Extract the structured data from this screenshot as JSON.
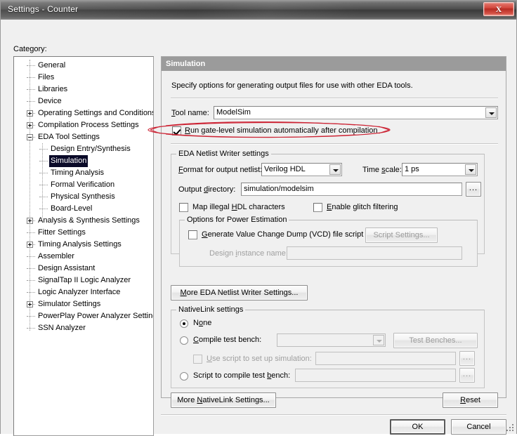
{
  "window": {
    "title": "Settings - Counter",
    "close_label": "X"
  },
  "sidebar": {
    "label": "Category:",
    "items": [
      {
        "label": "General",
        "level": 1,
        "expander": "none",
        "selected": false
      },
      {
        "label": "Files",
        "level": 1,
        "expander": "none",
        "selected": false
      },
      {
        "label": "Libraries",
        "level": 1,
        "expander": "none",
        "selected": false
      },
      {
        "label": "Device",
        "level": 1,
        "expander": "none",
        "selected": false
      },
      {
        "label": "Operating Settings and Conditions",
        "level": 1,
        "expander": "plus",
        "selected": false
      },
      {
        "label": "Compilation Process Settings",
        "level": 1,
        "expander": "plus",
        "selected": false
      },
      {
        "label": "EDA Tool Settings",
        "level": 1,
        "expander": "minus",
        "selected": false
      },
      {
        "label": "Design Entry/Synthesis",
        "level": 2,
        "expander": "none",
        "selected": false
      },
      {
        "label": "Simulation",
        "level": 2,
        "expander": "none",
        "selected": true
      },
      {
        "label": "Timing Analysis",
        "level": 2,
        "expander": "none",
        "selected": false
      },
      {
        "label": "Formal Verification",
        "level": 2,
        "expander": "none",
        "selected": false
      },
      {
        "label": "Physical Synthesis",
        "level": 2,
        "expander": "none",
        "selected": false
      },
      {
        "label": "Board-Level",
        "level": 2,
        "expander": "none",
        "selected": false
      },
      {
        "label": "Analysis & Synthesis Settings",
        "level": 1,
        "expander": "plus",
        "selected": false
      },
      {
        "label": "Fitter Settings",
        "level": 1,
        "expander": "none",
        "selected": false
      },
      {
        "label": "Timing Analysis Settings",
        "level": 1,
        "expander": "plus",
        "selected": false
      },
      {
        "label": "Assembler",
        "level": 1,
        "expander": "none",
        "selected": false
      },
      {
        "label": "Design Assistant",
        "level": 1,
        "expander": "none",
        "selected": false
      },
      {
        "label": "SignalTap II Logic Analyzer",
        "level": 1,
        "expander": "none",
        "selected": false
      },
      {
        "label": "Logic Analyzer Interface",
        "level": 1,
        "expander": "none",
        "selected": false
      },
      {
        "label": "Simulator Settings",
        "level": 1,
        "expander": "plus",
        "selected": false
      },
      {
        "label": "PowerPlay Power Analyzer Settings",
        "level": 1,
        "expander": "none",
        "selected": false
      },
      {
        "label": "SSN Analyzer",
        "level": 1,
        "expander": "none",
        "selected": false
      }
    ]
  },
  "panel": {
    "header": "Simulation",
    "description": "Specify options for generating output files for use with other EDA tools.",
    "tool_name_label": "Tool name:",
    "tool_name_value": "ModelSim",
    "run_gatelevel_label": "Run gate-level simulation automatically after compilation",
    "run_gatelevel_checked": true
  },
  "netlist_writer": {
    "title": "EDA Netlist Writer settings",
    "format_label": "Format for output netlist:",
    "format_value": "Verilog HDL",
    "timescale_label": "Time scale:",
    "timescale_value": "1 ps",
    "output_dir_label": "Output directory:",
    "output_dir_value": "simulation/modelsim",
    "browse_label": "...",
    "map_illegal_label": "Map illegal HDL characters",
    "map_illegal_checked": false,
    "glitch_label": "Enable glitch filtering",
    "glitch_checked": false,
    "power": {
      "title": "Options for Power Estimation",
      "vcd_label": "Generate Value Change Dump (VCD) file script",
      "vcd_checked": false,
      "script_settings_label": "Script Settings...",
      "design_instance_label": "Design instance name:",
      "design_instance_value": ""
    },
    "more_settings_label": "More EDA Netlist Writer Settings..."
  },
  "nativelink": {
    "title": "NativeLink settings",
    "none_label": "None",
    "none_selected": true,
    "compile_tb_label": "Compile test bench:",
    "compile_tb_selected": false,
    "compile_tb_value": "",
    "test_benches_label": "Test Benches...",
    "use_script_label": "Use script to set up simulation:",
    "use_script_checked": false,
    "use_script_value": "",
    "use_script_browse": "...",
    "script_tb_label": "Script to compile test bench:",
    "script_tb_selected": false,
    "script_tb_value": "",
    "script_tb_browse": "...",
    "more_settings_label": "More NativeLink Settings...",
    "reset_label": "Reset"
  },
  "footer": {
    "ok_label": "OK",
    "cancel_label": "Cancel"
  },
  "annotation": {
    "color": "#cc2233",
    "target": "run_gatelevel_checkbox_row"
  }
}
